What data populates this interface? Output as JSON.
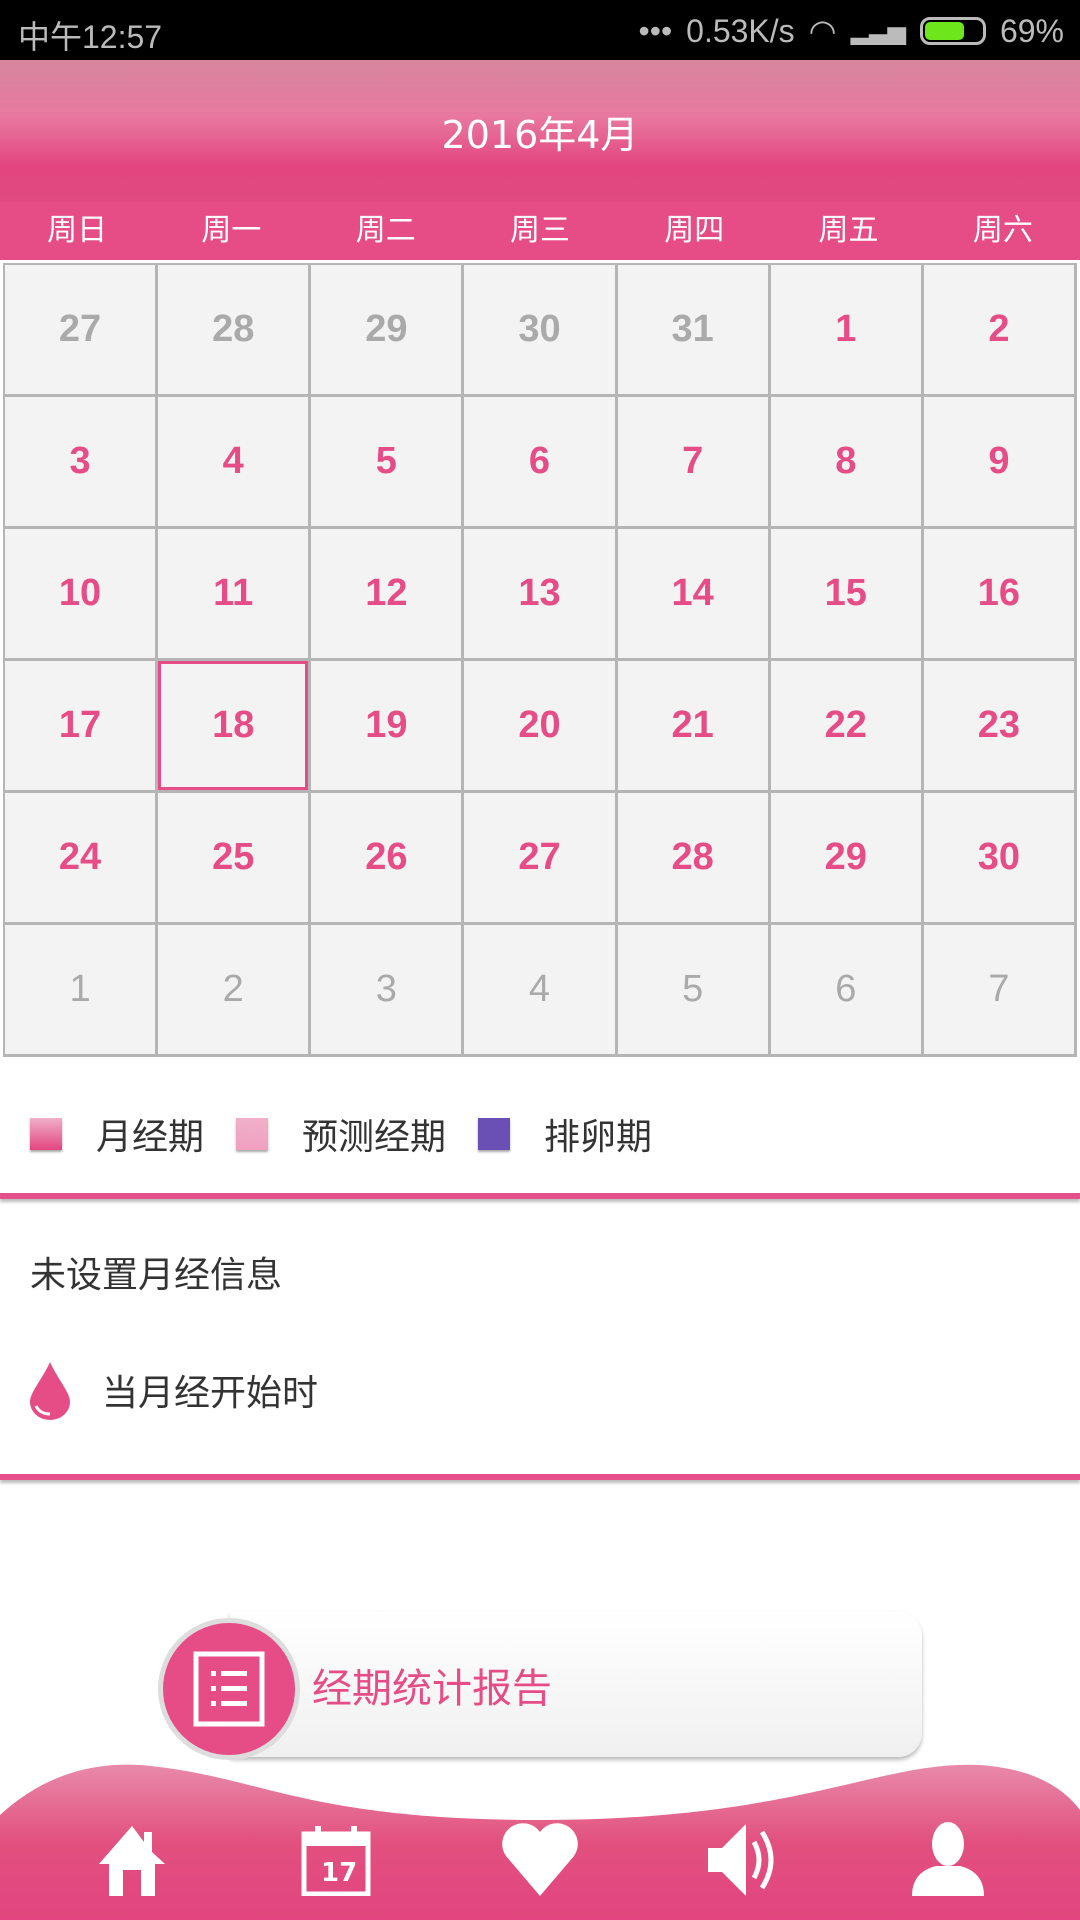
{
  "status_bar": {
    "time": "中午12:57",
    "net_speed": "0.53K/s",
    "battery": "69%",
    "battery_level": 0.69
  },
  "header": {
    "title": "2016年4月"
  },
  "weekdays": [
    "周日",
    "周一",
    "周二",
    "周三",
    "周四",
    "周五",
    "周六"
  ],
  "calendar": {
    "days": [
      {
        "d": "27",
        "other": true
      },
      {
        "d": "28",
        "other": true
      },
      {
        "d": "29",
        "other": true
      },
      {
        "d": "30",
        "other": true
      },
      {
        "d": "31",
        "other": true
      },
      {
        "d": "1"
      },
      {
        "d": "2"
      },
      {
        "d": "3"
      },
      {
        "d": "4"
      },
      {
        "d": "5"
      },
      {
        "d": "6"
      },
      {
        "d": "7"
      },
      {
        "d": "8"
      },
      {
        "d": "9"
      },
      {
        "d": "10"
      },
      {
        "d": "11"
      },
      {
        "d": "12"
      },
      {
        "d": "13"
      },
      {
        "d": "14"
      },
      {
        "d": "15"
      },
      {
        "d": "16"
      },
      {
        "d": "17"
      },
      {
        "d": "18",
        "selected": true
      },
      {
        "d": "19"
      },
      {
        "d": "20"
      },
      {
        "d": "21"
      },
      {
        "d": "22"
      },
      {
        "d": "23"
      },
      {
        "d": "24"
      },
      {
        "d": "25"
      },
      {
        "d": "26"
      },
      {
        "d": "27"
      },
      {
        "d": "28"
      },
      {
        "d": "29"
      },
      {
        "d": "30"
      },
      {
        "d": "1",
        "other": true
      },
      {
        "d": "2",
        "other": true
      },
      {
        "d": "3",
        "other": true
      },
      {
        "d": "4",
        "other": true
      },
      {
        "d": "5",
        "other": true
      },
      {
        "d": "6",
        "other": true
      },
      {
        "d": "7",
        "other": true
      }
    ]
  },
  "legend": [
    {
      "label": "月经期",
      "color": "#e2457f"
    },
    {
      "label": "预测经期",
      "color": "#f0a0bf"
    },
    {
      "label": "排卵期",
      "color": "#6a4fb5"
    }
  ],
  "info": {
    "status": "未设置月经信息",
    "start_prompt": "当月经开始时"
  },
  "report_button": {
    "label": "经期统计报告"
  },
  "nav": {
    "items": [
      "home-icon",
      "calendar-icon",
      "heart-icon",
      "speaker-icon",
      "user-icon"
    ],
    "calendar_day": "17"
  },
  "colors": {
    "accent": "#e64c86"
  }
}
